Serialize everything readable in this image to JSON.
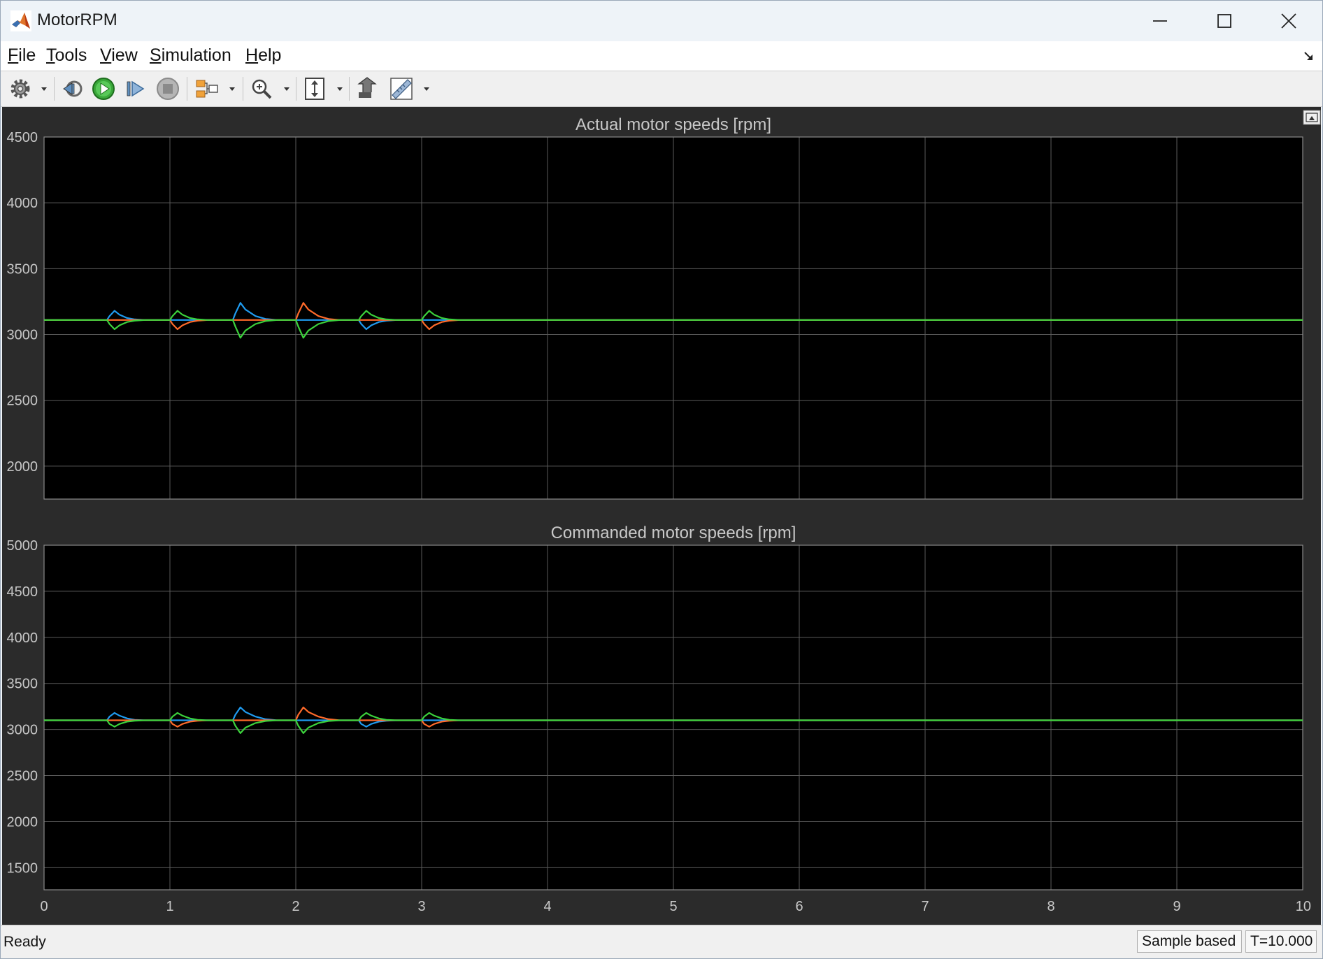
{
  "window": {
    "title": "MotorRPM"
  },
  "menu": [
    {
      "label": "File",
      "accel": "F",
      "rest": "ile"
    },
    {
      "label": "Tools",
      "accel": "T",
      "rest": "ools"
    },
    {
      "label": "View",
      "accel": "V",
      "rest": "iew"
    },
    {
      "label": "Simulation",
      "accel": "S",
      "rest": "imulation"
    },
    {
      "label": "Help",
      "accel": "H",
      "rest": "elp"
    }
  ],
  "toolbar": {
    "icons": [
      "settings-gear-icon",
      "step-back-icon",
      "run-icon",
      "step-forward-icon",
      "stop-icon",
      "signal-selection-icon",
      "zoom-icon",
      "scale-axes-icon",
      "highlight-block-icon",
      "measurements-icon"
    ]
  },
  "status": {
    "text": "Ready",
    "sample_mode": "Sample based",
    "time": "T=10.000"
  },
  "colors": {
    "background": "#2b2b2b",
    "plot_bg": "#000000",
    "grid": "#5a5a5a",
    "text": "#c8c8c8",
    "series": [
      "#1f9bf0",
      "#ff6a2a",
      "#3cd23c"
    ]
  },
  "chart_data": [
    {
      "type": "line",
      "title": "Actual motor speeds [rpm]",
      "xlabel": "",
      "ylabel": "",
      "xlim": [
        0,
        10
      ],
      "ylim": [
        1750,
        4500
      ],
      "xticks": [
        0,
        1,
        2,
        3,
        4,
        5,
        6,
        7,
        8,
        9,
        10
      ],
      "yticks": [
        2000,
        2500,
        3000,
        3500,
        4000,
        4500
      ],
      "show_xtick_labels": false,
      "grid": true,
      "baseline": 3110,
      "series": [
        {
          "color": "#1f9bf0",
          "x": [
            0,
            0.5,
            0.52,
            0.56,
            0.6,
            0.66,
            0.72,
            0.8,
            1.5,
            1.52,
            1.56,
            1.6,
            1.68,
            1.76,
            1.85,
            2.5,
            2.52,
            2.56,
            2.6,
            2.66,
            2.72,
            2.8,
            10
          ],
          "y": [
            3110,
            3110,
            3140,
            3180,
            3150,
            3125,
            3115,
            3110,
            3110,
            3160,
            3240,
            3190,
            3140,
            3118,
            3110,
            3110,
            3080,
            3040,
            3070,
            3095,
            3105,
            3110,
            3110
          ]
        },
        {
          "color": "#ff6a2a",
          "x": [
            0,
            1.0,
            1.02,
            1.06,
            1.1,
            1.16,
            1.22,
            1.3,
            2.0,
            2.02,
            2.06,
            2.1,
            2.18,
            2.26,
            2.35,
            3.0,
            3.02,
            3.06,
            3.1,
            3.16,
            3.22,
            3.3,
            10
          ],
          "y": [
            3110,
            3110,
            3080,
            3040,
            3070,
            3095,
            3105,
            3110,
            3110,
            3160,
            3240,
            3190,
            3140,
            3118,
            3110,
            3110,
            3080,
            3040,
            3070,
            3095,
            3105,
            3110,
            3110
          ]
        },
        {
          "color": "#3cd23c",
          "x": [
            0,
            0.5,
            0.52,
            0.56,
            0.6,
            0.66,
            0.72,
            0.8,
            1.0,
            1.02,
            1.06,
            1.1,
            1.16,
            1.22,
            1.3,
            1.5,
            1.52,
            1.56,
            1.6,
            1.68,
            1.76,
            1.85,
            2.0,
            2.02,
            2.06,
            2.1,
            2.18,
            2.26,
            2.35,
            2.5,
            2.52,
            2.56,
            2.6,
            2.66,
            2.72,
            2.8,
            3.0,
            3.02,
            3.06,
            3.1,
            3.16,
            3.22,
            3.3,
            10
          ],
          "y": [
            3110,
            3110,
            3080,
            3040,
            3070,
            3095,
            3105,
            3110,
            3110,
            3140,
            3180,
            3150,
            3125,
            3115,
            3110,
            3110,
            3060,
            2975,
            3030,
            3080,
            3102,
            3110,
            3110,
            3060,
            2975,
            3030,
            3080,
            3102,
            3110,
            3110,
            3140,
            3180,
            3150,
            3125,
            3115,
            3110,
            3110,
            3140,
            3180,
            3150,
            3125,
            3115,
            3110,
            3110
          ]
        }
      ]
    },
    {
      "type": "line",
      "title": "Commanded motor speeds [rpm]",
      "xlabel": "",
      "ylabel": "",
      "xlim": [
        0,
        10
      ],
      "ylim": [
        1260,
        5000
      ],
      "xticks": [
        0,
        1,
        2,
        3,
        4,
        5,
        6,
        7,
        8,
        9,
        10
      ],
      "yticks": [
        1500,
        2000,
        2500,
        3000,
        3500,
        4000,
        4500,
        5000
      ],
      "show_xtick_labels": true,
      "grid": true,
      "baseline": 3100,
      "series": [
        {
          "color": "#1f9bf0",
          "x": [
            0,
            0.5,
            0.52,
            0.56,
            0.6,
            0.66,
            0.72,
            0.8,
            1.5,
            1.52,
            1.56,
            1.6,
            1.68,
            1.76,
            1.85,
            2.5,
            2.52,
            2.56,
            2.6,
            2.66,
            2.72,
            2.8,
            10
          ],
          "y": [
            3100,
            3100,
            3140,
            3180,
            3150,
            3120,
            3105,
            3100,
            3100,
            3160,
            3240,
            3190,
            3140,
            3112,
            3100,
            3100,
            3060,
            3030,
            3060,
            3085,
            3095,
            3100,
            3100
          ]
        },
        {
          "color": "#ff6a2a",
          "x": [
            0,
            1.0,
            1.02,
            1.06,
            1.1,
            1.16,
            1.22,
            1.3,
            2.0,
            2.02,
            2.06,
            2.1,
            2.18,
            2.26,
            2.35,
            3.0,
            3.02,
            3.06,
            3.1,
            3.16,
            3.22,
            3.3,
            10
          ],
          "y": [
            3100,
            3100,
            3060,
            3030,
            3060,
            3085,
            3095,
            3100,
            3100,
            3160,
            3240,
            3190,
            3140,
            3112,
            3100,
            3100,
            3060,
            3030,
            3060,
            3085,
            3095,
            3100,
            3100
          ]
        },
        {
          "color": "#3cd23c",
          "x": [
            0,
            0.5,
            0.52,
            0.56,
            0.6,
            0.66,
            0.72,
            0.8,
            1.0,
            1.02,
            1.06,
            1.1,
            1.16,
            1.22,
            1.3,
            1.5,
            1.52,
            1.56,
            1.6,
            1.68,
            1.76,
            1.85,
            2.0,
            2.02,
            2.06,
            2.1,
            2.18,
            2.26,
            2.35,
            2.5,
            2.52,
            2.56,
            2.6,
            2.66,
            2.72,
            2.8,
            3.0,
            3.02,
            3.06,
            3.1,
            3.16,
            3.22,
            3.3,
            10
          ],
          "y": [
            3100,
            3100,
            3060,
            3030,
            3060,
            3085,
            3095,
            3100,
            3100,
            3140,
            3180,
            3150,
            3120,
            3105,
            3100,
            3100,
            3040,
            2960,
            3020,
            3070,
            3092,
            3100,
            3100,
            3040,
            2960,
            3020,
            3070,
            3092,
            3100,
            3100,
            3140,
            3180,
            3150,
            3120,
            3105,
            3100,
            3100,
            3140,
            3180,
            3150,
            3120,
            3105,
            3100,
            3100
          ]
        }
      ]
    }
  ]
}
